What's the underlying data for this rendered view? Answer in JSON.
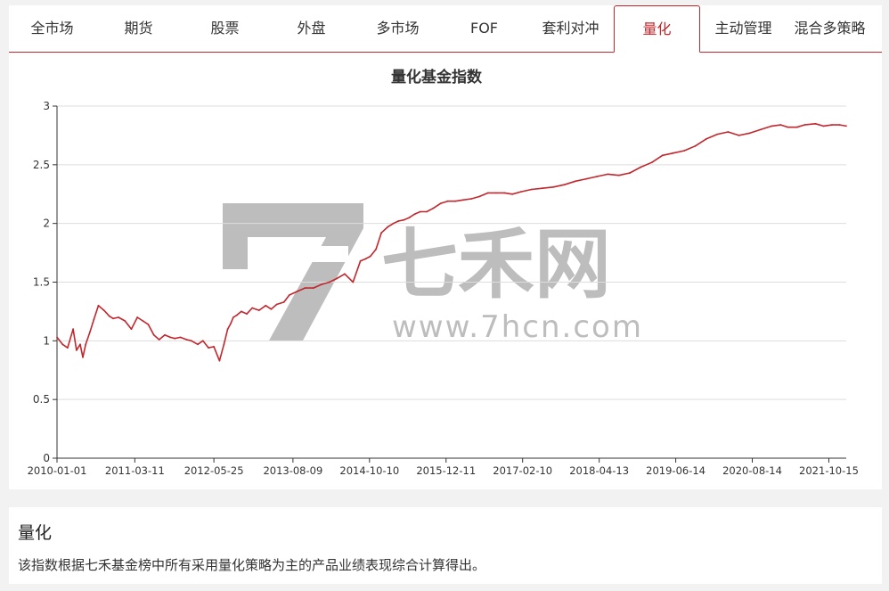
{
  "tabs": [
    {
      "label": "全市场",
      "active": false
    },
    {
      "label": "期货",
      "active": false
    },
    {
      "label": "股票",
      "active": false
    },
    {
      "label": "外盘",
      "active": false
    },
    {
      "label": "多市场",
      "active": false
    },
    {
      "label": "FOF",
      "active": false
    },
    {
      "label": "套利对冲",
      "active": false
    },
    {
      "label": "量化",
      "active": true
    },
    {
      "label": "主动管理",
      "active": false
    },
    {
      "label": "混合多策略",
      "active": false
    }
  ],
  "watermark": {
    "brand": "七禾网",
    "url": "www.7hcn.com"
  },
  "colors": {
    "accent": "#c1272d",
    "line": "#c1272d",
    "grid": "#dddddd",
    "axis": "#333333"
  },
  "info": {
    "title": "量化",
    "description": "该指数根据七禾基金榜中所有采用量化策略为主的产品业绩表现综合计算得出。"
  },
  "chart_data": {
    "type": "line",
    "title": "量化基金指数",
    "xlabel": "",
    "ylabel": "",
    "xlim": [
      "2010-01-01",
      "2022-01-20"
    ],
    "ylim": [
      0,
      3
    ],
    "y_ticks": [
      0,
      0.5,
      1,
      1.5,
      2,
      2.5,
      3
    ],
    "x_tick_labels": [
      "2010-01-01",
      "2011-03-11",
      "2012-05-25",
      "2013-08-09",
      "2014-10-10",
      "2015-12-11",
      "2017-02-10",
      "2018-04-13",
      "2019-06-14",
      "2020-08-14",
      "2021-10-15"
    ],
    "grid": true,
    "series": [
      {
        "x": [
          "2010-01-01",
          "2010-02-01",
          "2010-03-01",
          "2010-04-01",
          "2010-04-20",
          "2010-05-10",
          "2010-05-25",
          "2010-06-10",
          "2010-07-05",
          "2010-07-25",
          "2010-08-20",
          "2010-09-20",
          "2010-10-20",
          "2010-11-10",
          "2010-12-10",
          "2011-01-15",
          "2011-02-20",
          "2011-03-25",
          "2011-04-25",
          "2011-05-25",
          "2011-06-25",
          "2011-07-25",
          "2011-08-25",
          "2011-09-25",
          "2011-10-20",
          "2011-11-20",
          "2011-12-25",
          "2012-01-20",
          "2012-02-25",
          "2012-03-25",
          "2012-04-25",
          "2012-05-25",
          "2012-06-25",
          "2012-07-20",
          "2012-08-10",
          "2012-08-28",
          "2012-09-10",
          "2012-10-01",
          "2012-10-25",
          "2012-11-25",
          "2012-12-25",
          "2013-02-01",
          "2013-03-10",
          "2013-04-10",
          "2013-05-10",
          "2013-06-20",
          "2013-07-20",
          "2013-09-01",
          "2013-10-15",
          "2013-12-01",
          "2014-01-15",
          "2014-03-01",
          "2014-04-10",
          "2014-05-25",
          "2014-07-10",
          "2014-08-20",
          "2014-09-20",
          "2014-10-15",
          "2014-11-15",
          "2014-12-15",
          "2015-01-20",
          "2015-02-20",
          "2015-03-20",
          "2015-04-20",
          "2015-05-20",
          "2015-06-20",
          "2015-07-20",
          "2015-08-25",
          "2015-10-01",
          "2015-11-10",
          "2015-12-20",
          "2016-02-01",
          "2016-03-15",
          "2016-05-01",
          "2016-06-15",
          "2016-08-01",
          "2016-09-15",
          "2016-11-01",
          "2016-12-15",
          "2017-02-01",
          "2017-04-01",
          "2017-06-01",
          "2017-08-01",
          "2017-10-01",
          "2017-12-01",
          "2018-02-01",
          "2018-04-01",
          "2018-06-01",
          "2018-08-01",
          "2018-10-01",
          "2018-12-01",
          "2019-02-01",
          "2019-04-01",
          "2019-06-01",
          "2019-08-01",
          "2019-10-01",
          "2019-12-01",
          "2020-02-01",
          "2020-04-01",
          "2020-06-01",
          "2020-08-01",
          "2020-10-01",
          "2020-12-01",
          "2021-01-20",
          "2021-03-01",
          "2021-04-20",
          "2021-06-01",
          "2021-08-01",
          "2021-09-15",
          "2021-11-01",
          "2021-12-15",
          "2022-01-20"
        ],
        "y": [
          1.03,
          0.97,
          0.94,
          1.1,
          0.92,
          0.97,
          0.86,
          0.97,
          1.08,
          1.18,
          1.3,
          1.26,
          1.21,
          1.19,
          1.2,
          1.17,
          1.1,
          1.2,
          1.17,
          1.14,
          1.05,
          1.01,
          1.05,
          1.03,
          1.02,
          1.03,
          1.01,
          1.0,
          0.97,
          1.0,
          0.94,
          0.95,
          0.83,
          0.97,
          1.1,
          1.15,
          1.2,
          1.22,
          1.25,
          1.23,
          1.28,
          1.26,
          1.3,
          1.27,
          1.31,
          1.33,
          1.39,
          1.42,
          1.45,
          1.45,
          1.48,
          1.5,
          1.53,
          1.57,
          1.5,
          1.68,
          1.7,
          1.72,
          1.78,
          1.92,
          1.97,
          2.0,
          2.02,
          2.03,
          2.05,
          2.08,
          2.1,
          2.1,
          2.13,
          2.17,
          2.19,
          2.19,
          2.2,
          2.21,
          2.23,
          2.26,
          2.26,
          2.26,
          2.25,
          2.27,
          2.29,
          2.3,
          2.31,
          2.33,
          2.36,
          2.38,
          2.4,
          2.42,
          2.41,
          2.43,
          2.48,
          2.52,
          2.58,
          2.6,
          2.62,
          2.66,
          2.72,
          2.76,
          2.78,
          2.75,
          2.77,
          2.8,
          2.83,
          2.84,
          2.82,
          2.82,
          2.84,
          2.85,
          2.83,
          2.84,
          2.84,
          2.83
        ]
      }
    ]
  }
}
